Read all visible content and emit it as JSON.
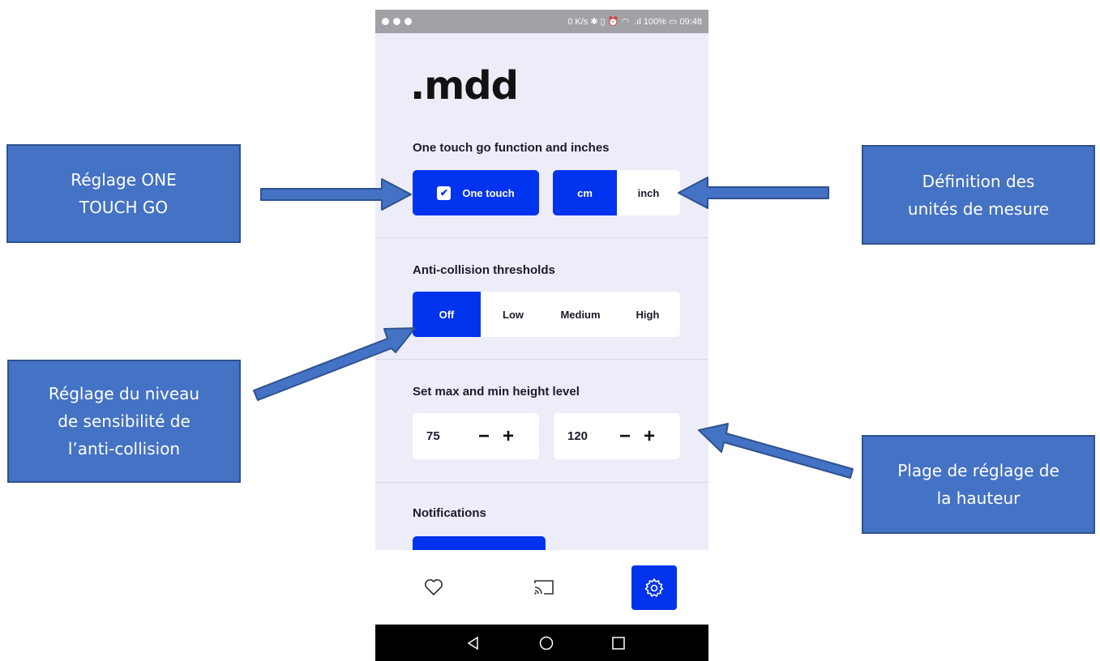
{
  "callouts": {
    "one_touch": [
      "Réglage ONE",
      "TOUCH GO"
    ],
    "units": [
      "Définition des",
      "unités de mesure"
    ],
    "anticollision": [
      "Réglage du niveau",
      "de sensibilité de",
      "l’anti-collision"
    ],
    "height": [
      "Plage de réglage de",
      "la hauteur"
    ]
  },
  "status_bar": {
    "right_text": "0 K/s ✱ ▯ ⏰ ◠  .ıl 100% ▭ 09:48"
  },
  "app": {
    "logo": ".mdd",
    "section1": {
      "title": "One touch go function and inches",
      "one_touch_label": "One touch",
      "one_touch_checked": true,
      "units": [
        "cm",
        "inch"
      ],
      "selected_unit": "cm"
    },
    "section2": {
      "title": "Anti-collision thresholds",
      "options": [
        "Off",
        "Low",
        "Medium",
        "High"
      ],
      "selected": "Off"
    },
    "section3": {
      "title": "Set max and min height level",
      "min_value": "75",
      "max_value": "120",
      "minus": "−",
      "plus": "+"
    },
    "section4": {
      "title": "Notifications"
    },
    "bottom_nav": [
      "heart-icon",
      "cast-icon",
      "gear-icon"
    ],
    "active_tab": "gear-icon"
  },
  "colors": {
    "accent": "#0033ee",
    "callout_bg": "#4472c4",
    "app_bg": "#ecedf8"
  }
}
